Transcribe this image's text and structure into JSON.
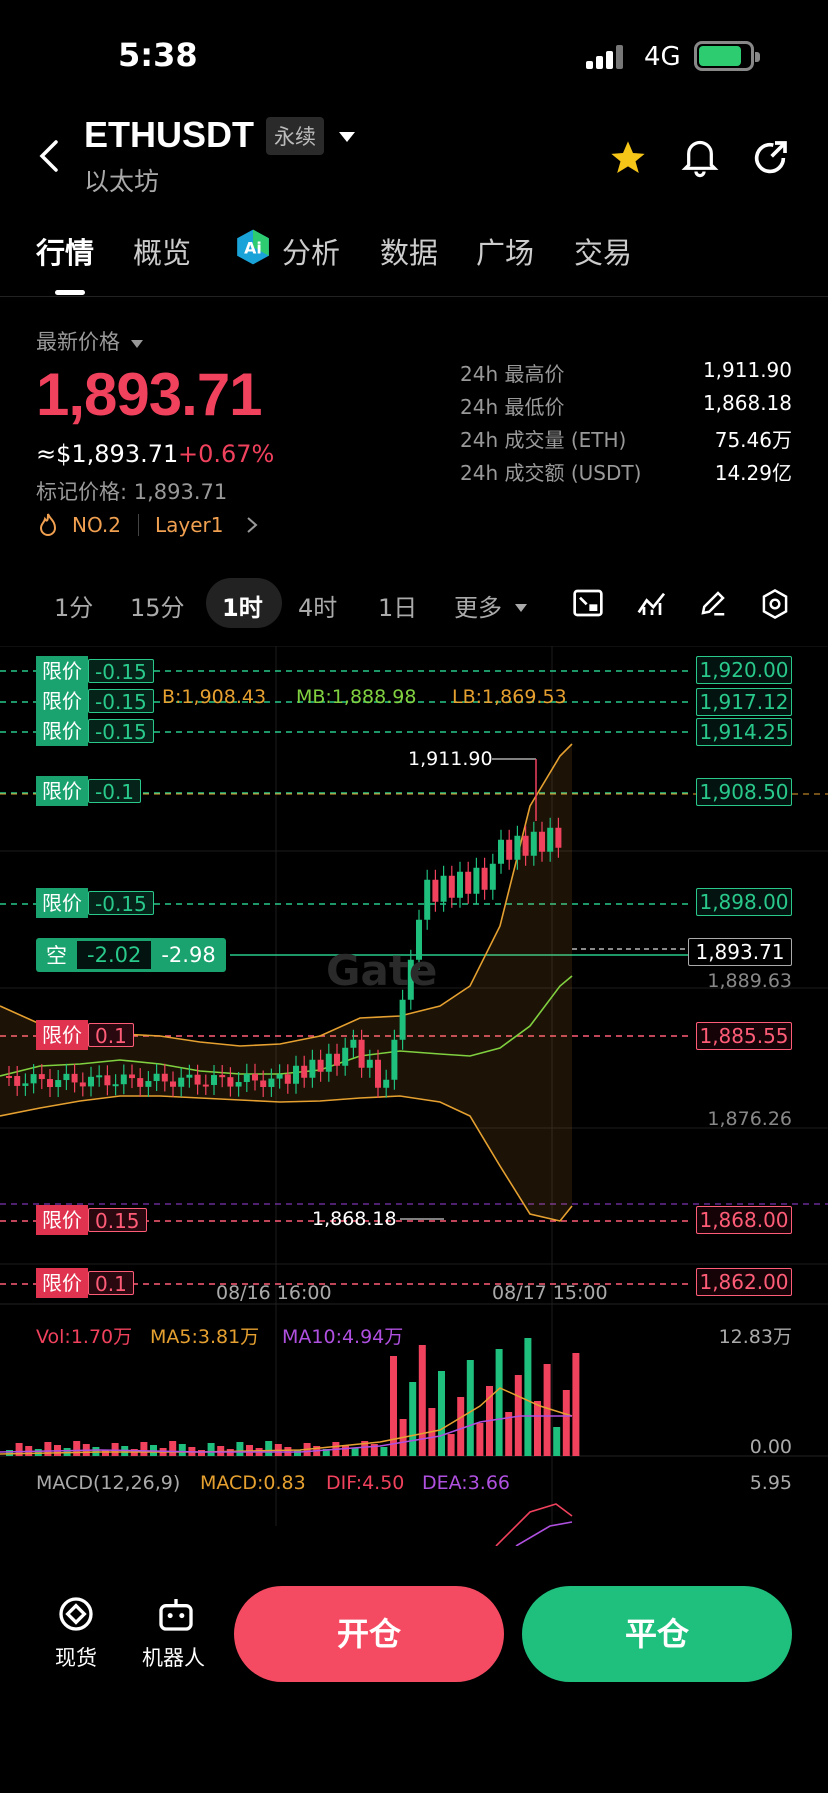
{
  "status": {
    "time": "5:38",
    "network": "4G"
  },
  "header": {
    "symbol": "ETHUSDT",
    "contract_type": "永续",
    "subtitle": "以太坊"
  },
  "tabs": [
    "行情",
    "概览",
    "分析",
    "数据",
    "广场",
    "交易"
  ],
  "price": {
    "latest_label": "最新价格",
    "last": "1,893.71",
    "usd": "≈$1,893.71",
    "change": "+0.67%",
    "mark": "标记价格: 1,893.71",
    "rank": "NO.2",
    "tag": "Layer1"
  },
  "stats": [
    {
      "label": "24h 最高价",
      "value": "1,911.90"
    },
    {
      "label": "24h 最低价",
      "value": "1,868.18"
    },
    {
      "label": "24h 成交量 (ETH)",
      "value": "75.46万"
    },
    {
      "label": "24h 成交额 (USDT)",
      "value": "14.29亿"
    }
  ],
  "timeframes": [
    "1分",
    "15分",
    "1时",
    "4时",
    "1日",
    "更多"
  ],
  "chart": {
    "indicators": {
      "ub": "B:1,908.43",
      "mb": "MB:1,888.98",
      "lb": "LB:1,869.53"
    },
    "high_marker": "1,911.90",
    "low_marker": "1,868.18",
    "watermark": "Gate",
    "orders": [
      {
        "label": "限价",
        "value": "-0.15",
        "price": "1,920.00",
        "side": "buy"
      },
      {
        "label": "限价",
        "value": "-0.15",
        "price": "1,917.12",
        "side": "buy"
      },
      {
        "label": "限价",
        "value": "-0.15",
        "price": "1,914.25",
        "side": "buy"
      },
      {
        "label": "限价",
        "value": "-0.1",
        "price": "1,908.50",
        "side": "buy"
      },
      {
        "label": "限价",
        "value": "-0.15",
        "price": "1,898.00",
        "side": "buy"
      },
      {
        "label": "限价",
        "value": "0.1",
        "price": "1,885.55",
        "side": "sell"
      },
      {
        "label": "限价",
        "value": "0.15",
        "price": "1,868.00",
        "side": "sell"
      },
      {
        "label": "限价",
        "value": "0.1",
        "price": "1,862.00",
        "side": "sell"
      }
    ],
    "position": {
      "label": "空",
      "pnl": "-2.02",
      "size": "-2.98"
    },
    "current_price": "1,893.71",
    "axis_prices": [
      "1,889.63",
      "1,876.26"
    ],
    "time_labels": [
      "08/16 16:00",
      "08/17 15:00"
    ],
    "volume": {
      "vol": "Vol:1.70万",
      "ma5": "MA5:3.81万",
      "ma10": "MA10:4.94万",
      "max": "12.83万",
      "zero": "0.00"
    },
    "macd": {
      "title": "MACD(12,26,9)",
      "macd": "MACD:0.83",
      "dif": "DIF:4.50",
      "dea": "DEA:3.66",
      "max": "5.95"
    }
  },
  "bottom": {
    "spot": "现货",
    "bot": "机器人",
    "open": "开仓",
    "close": "平仓"
  }
}
